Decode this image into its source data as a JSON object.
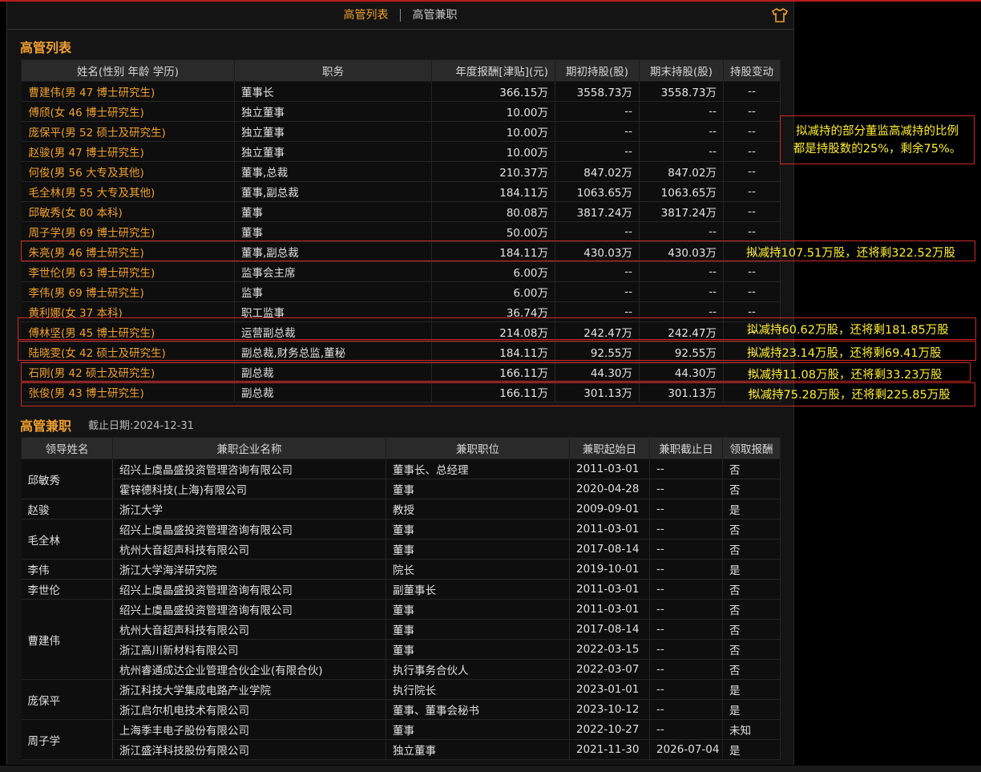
{
  "tabs": [
    {
      "label": "高管列表"
    },
    {
      "label": "高管兼职"
    }
  ],
  "exec_section": {
    "title": "高管列表",
    "headers": [
      "姓名(性别 年龄 学历)",
      "职务",
      "年度报酬[津贴](元)",
      "期初持股(股)",
      "期末持股(股)",
      "持股变动"
    ],
    "rows": [
      {
        "name": "曹建伟(男 47 博士研究生)",
        "role": "董事长",
        "pay": "366.15万",
        "start": "3558.73万",
        "end": "3558.73万",
        "change": "--"
      },
      {
        "name": "傅颀(女 46 博士研究生)",
        "role": "独立董事",
        "pay": "10.00万",
        "start": "--",
        "end": "--",
        "change": "--"
      },
      {
        "name": "庞保平(男 52 硕士及研究生)",
        "role": "独立董事",
        "pay": "10.00万",
        "start": "--",
        "end": "--",
        "change": "--"
      },
      {
        "name": "赵骏(男 47 博士研究生)",
        "role": "独立董事",
        "pay": "10.00万",
        "start": "--",
        "end": "--",
        "change": "--"
      },
      {
        "name": "何俊(男 56 大专及其他)",
        "role": "董事,总裁",
        "pay": "210.37万",
        "start": "847.02万",
        "end": "847.02万",
        "change": "--"
      },
      {
        "name": "毛全林(男 55 大专及其他)",
        "role": "董事,副总裁",
        "pay": "184.11万",
        "start": "1063.65万",
        "end": "1063.65万",
        "change": "--"
      },
      {
        "name": "邱敏秀(女 80 本科)",
        "role": "董事",
        "pay": "80.08万",
        "start": "3817.24万",
        "end": "3817.24万",
        "change": "--"
      },
      {
        "name": "周子学(男 69 博士研究生)",
        "role": "董事",
        "pay": "50.00万",
        "start": "--",
        "end": "--",
        "change": "--"
      },
      {
        "name": "朱亮(男 46 博士研究生)",
        "role": "董事,副总裁",
        "pay": "184.11万",
        "start": "430.03万",
        "end": "430.03万",
        "change": "--"
      },
      {
        "name": "李世伦(男 63 博士研究生)",
        "role": "监事会主席",
        "pay": "6.00万",
        "start": "--",
        "end": "--",
        "change": "--"
      },
      {
        "name": "李伟(男 69 博士研究生)",
        "role": "监事",
        "pay": "6.00万",
        "start": "--",
        "end": "--",
        "change": "--"
      },
      {
        "name": "黄利娜(女 37 本科)",
        "role": "职工监事",
        "pay": "36.74万",
        "start": "--",
        "end": "--",
        "change": "--"
      },
      {
        "name": "傅林坚(男 45 博士研究生)",
        "role": "运营副总裁",
        "pay": "214.08万",
        "start": "242.47万",
        "end": "242.47万",
        "change": "--"
      },
      {
        "name": "陆晓雯(女 42 硕士及研究生)",
        "role": "副总裁,财务总监,董秘",
        "pay": "184.11万",
        "start": "92.55万",
        "end": "92.55万",
        "change": "--"
      },
      {
        "name": "石刚(男 42 硕士及研究生)",
        "role": "副总裁",
        "pay": "166.11万",
        "start": "44.30万",
        "end": "44.30万",
        "change": "--"
      },
      {
        "name": "张俊(男 43 博士研究生)",
        "role": "副总裁",
        "pay": "166.11万",
        "start": "301.13万",
        "end": "301.13万",
        "change": "--"
      }
    ]
  },
  "annotations": {
    "summary": [
      "拟减持的部分董监高减持的比例",
      "都是持股数的25%，剩余75%。"
    ],
    "zhu_liang": "拟减持107.51万股，还将剩322.52万股",
    "fu_linjian": "拟减持60.62万股，还将剩181.85万股",
    "lu_xiaowen": "拟减持23.14万股，还将剩69.41万股",
    "shi_gang": "拟减持11.08万股，还将剩33.23万股",
    "zhang_jun": "拟减持75.28万股，还将剩225.85万股"
  },
  "parttime_section": {
    "title": "高管兼职",
    "date": "截止日期:2024-12-31",
    "headers": [
      "领导姓名",
      "兼职企业名称",
      "兼职职位",
      "兼职起始日",
      "兼职截止日",
      "领取报酬"
    ],
    "groups": [
      {
        "leader": "邱敏秀",
        "rows": [
          {
            "company": "绍兴上虞晶盛投资管理咨询有限公司",
            "position": "董事长、总经理",
            "start": "2011-03-01",
            "end": "--",
            "paid": "否"
          },
          {
            "company": "霍锌德科技(上海)有限公司",
            "position": "董事",
            "start": "2020-04-28",
            "end": "--",
            "paid": "否"
          }
        ]
      },
      {
        "leader": "赵骏",
        "rows": [
          {
            "company": "浙江大学",
            "position": "教授",
            "start": "2009-09-01",
            "end": "--",
            "paid": "是"
          }
        ]
      },
      {
        "leader": "毛全林",
        "rows": [
          {
            "company": "绍兴上虞晶盛投资管理咨询有限公司",
            "position": "董事",
            "start": "2011-03-01",
            "end": "--",
            "paid": "否"
          },
          {
            "company": "杭州大音超声科技有限公司",
            "position": "董事",
            "start": "2017-08-14",
            "end": "--",
            "paid": "否"
          }
        ]
      },
      {
        "leader": "李伟",
        "rows": [
          {
            "company": "浙江大学海洋研究院",
            "position": "院长",
            "start": "2019-10-01",
            "end": "--",
            "paid": "是"
          }
        ]
      },
      {
        "leader": "李世伦",
        "rows": [
          {
            "company": "绍兴上虞晶盛投资管理咨询有限公司",
            "position": "副董事长",
            "start": "2011-03-01",
            "end": "--",
            "paid": "否"
          }
        ]
      },
      {
        "leader": "曹建伟",
        "rows": [
          {
            "company": "绍兴上虞晶盛投资管理咨询有限公司",
            "position": "董事",
            "start": "2011-03-01",
            "end": "--",
            "paid": "否"
          },
          {
            "company": "杭州大音超声科技有限公司",
            "position": "董事",
            "start": "2017-08-14",
            "end": "--",
            "paid": "否"
          },
          {
            "company": "浙江高川新材料有限公司",
            "position": "董事",
            "start": "2022-03-15",
            "end": "--",
            "paid": "否"
          },
          {
            "company": "杭州睿通成达企业管理合伙企业(有限合伙)",
            "position": "执行事务合伙人",
            "start": "2022-03-07",
            "end": "--",
            "paid": "否"
          }
        ]
      },
      {
        "leader": "庞保平",
        "rows": [
          {
            "company": "浙江科技大学集成电路产业学院",
            "position": "执行院长",
            "start": "2023-01-01",
            "end": "--",
            "paid": "是"
          },
          {
            "company": "浙江启尔机电技术有限公司",
            "position": "董事、董事会秘书",
            "start": "2023-10-12",
            "end": "--",
            "paid": "是"
          }
        ]
      },
      {
        "leader": "周子学",
        "rows": [
          {
            "company": "上海季丰电子股份有限公司",
            "position": "董事",
            "start": "2022-10-27",
            "end": "--",
            "paid": "未知"
          },
          {
            "company": "浙江盛洋科技股份有限公司",
            "position": "独立董事",
            "start": "2021-11-30",
            "end": "2026-07-04",
            "paid": "是"
          }
        ]
      }
    ]
  },
  "icons": {
    "top_right": "shirt-icon"
  },
  "colors": {
    "accent": "#f0a030",
    "highlight_border": "#d02828",
    "note_text": "#ffee33"
  }
}
